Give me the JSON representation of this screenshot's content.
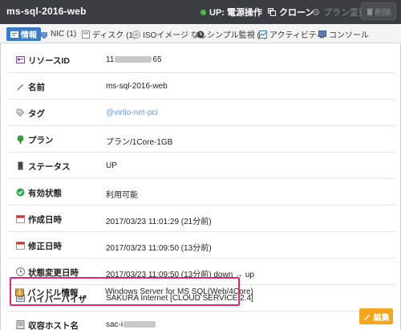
{
  "header": {
    "title": "ms-sql-2016-web",
    "status_label": "UP: 電源操作",
    "clone_label": "クローン",
    "plan_change_label": "プラン変更",
    "delete_label": "削除"
  },
  "tabs": [
    {
      "label": "情報"
    },
    {
      "label": "NIC (1)"
    },
    {
      "label": "ディスク (1)"
    },
    {
      "label": "ISOイメージ なし"
    },
    {
      "label": "シンプル監視 (0)"
    },
    {
      "label": "アクティビティ"
    },
    {
      "label": "コンソール"
    }
  ],
  "rows": [
    {
      "label": "リソースID",
      "value_prefix": "11",
      "value_suffix": "65"
    },
    {
      "label": "名前",
      "value": "ms-sql-2016-web"
    },
    {
      "label": "タグ",
      "value": "@virtio-net-pci"
    },
    {
      "label": "プラン",
      "value": "プラン/1Core-1GB"
    },
    {
      "label": "ステータス",
      "value": "UP"
    },
    {
      "label": "有効状態",
      "value": "利用可能"
    },
    {
      "label": "作成日時",
      "value": "2017/03/23 11:01:29 (21分前)"
    },
    {
      "label": "修正日時",
      "value": "2017/03/23 11:09:50 (13分前)"
    },
    {
      "label": "状態変更日時",
      "value": "2017/03/23 11:09:50 (13分前) down → up"
    },
    {
      "label": "ハイパーバイザ",
      "value": "SAKURA Internet [CLOUD SERVICE 2.4]"
    },
    {
      "label": "収容ホスト名",
      "value_prefix": "sac-i"
    },
    {
      "label": "バンドル情報",
      "value": "Windows Server for MS SQL(Web/4Core)"
    }
  ],
  "footer": {
    "edit_label": "編集"
  },
  "colors": {
    "topbar": "#3a3e42",
    "accent_tab": "#3b7cc4",
    "edit": "#f2a71e",
    "highlight": "#e0267c",
    "status_dot": "#4fb84f"
  }
}
